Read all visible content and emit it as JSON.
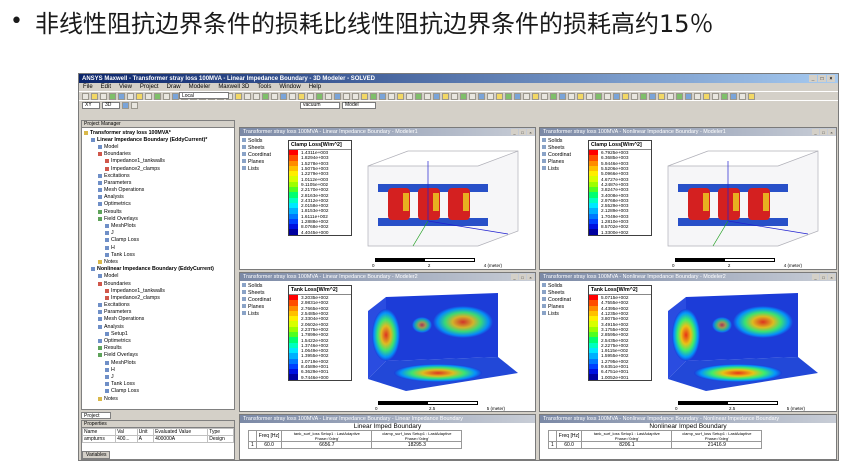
{
  "slide": {
    "bullet": "•",
    "title": "非线性阻抗边界条件的损耗比线性阻抗边界条件的损耗高约15％"
  },
  "app": {
    "title": "ANSYS Maxwell - Transformer stray loss 100MVA - Linear Impedance Boundary - 3D Modeler - SOLVED",
    "menu": [
      "File",
      "Edit",
      "View",
      "Project",
      "Draw",
      "Modeler",
      "Maxwell 3D",
      "Tools",
      "Window",
      "Help"
    ],
    "toolbar": {
      "plane": "XY",
      "mode": "3D",
      "cs": "Local",
      "material": "vacuum",
      "display": "Model"
    }
  },
  "project_manager": {
    "title": "Project Manager",
    "tab": "Project",
    "tree": [
      {
        "label": "Transformer stray loss 100MVA*",
        "level": 0,
        "icon": "project-icon"
      },
      {
        "label": "Linear Impedance Boundary (EddyCurrent)*",
        "level": 1,
        "icon": "design-icon"
      },
      {
        "label": "Model",
        "level": 2,
        "icon": "model-icon"
      },
      {
        "label": "Boundaries",
        "level": 2,
        "icon": "boundary-icon"
      },
      {
        "label": "Impedance1_tankwalls",
        "level": 3,
        "icon": "impedance-icon"
      },
      {
        "label": "Impedance2_clamps",
        "level": 3,
        "icon": "impedance-icon"
      },
      {
        "label": "Excitations",
        "level": 2,
        "icon": "excitation-icon"
      },
      {
        "label": "Parameters",
        "level": 2,
        "icon": "parameter-icon"
      },
      {
        "label": "Mesh Operations",
        "level": 2,
        "icon": "mesh-icon"
      },
      {
        "label": "Analysis",
        "level": 2,
        "icon": "analysis-icon"
      },
      {
        "label": "Optimetrics",
        "level": 2,
        "icon": "optimetrics-icon"
      },
      {
        "label": "Results",
        "level": 2,
        "icon": "results-icon"
      },
      {
        "label": "Field Overlays",
        "level": 2,
        "icon": "field-icon"
      },
      {
        "label": "MeshPlots",
        "level": 3,
        "icon": "folder-icon"
      },
      {
        "label": "J",
        "level": 3,
        "icon": "folder-icon"
      },
      {
        "label": "Clamp Loss",
        "level": 3,
        "icon": "folder-icon"
      },
      {
        "label": "H",
        "level": 3,
        "icon": "folder-icon"
      },
      {
        "label": "Tank Loss",
        "level": 3,
        "icon": "folder-icon"
      },
      {
        "label": "Notes",
        "level": 2,
        "icon": "notes-icon"
      },
      {
        "label": "Nonlinear Impedance Boundary (EddyCurrent)",
        "level": 1,
        "icon": "design-icon"
      },
      {
        "label": "Model",
        "level": 2,
        "icon": "model-icon"
      },
      {
        "label": "Boundaries",
        "level": 2,
        "icon": "boundary-icon"
      },
      {
        "label": "Impedance1_tankwalls",
        "level": 3,
        "icon": "impedance-icon"
      },
      {
        "label": "Impedance2_clamps",
        "level": 3,
        "icon": "impedance-icon"
      },
      {
        "label": "Excitations",
        "level": 2,
        "icon": "excitation-icon"
      },
      {
        "label": "Parameters",
        "level": 2,
        "icon": "parameter-icon"
      },
      {
        "label": "Mesh Operations",
        "level": 2,
        "icon": "mesh-icon"
      },
      {
        "label": "Analysis",
        "level": 2,
        "icon": "analysis-icon"
      },
      {
        "label": "Setup1",
        "level": 3,
        "icon": "setup-icon"
      },
      {
        "label": "Optimetrics",
        "level": 2,
        "icon": "optimetrics-icon"
      },
      {
        "label": "Results",
        "level": 2,
        "icon": "results-icon"
      },
      {
        "label": "Field Overlays",
        "level": 2,
        "icon": "field-icon"
      },
      {
        "label": "MeshPlots",
        "level": 3,
        "icon": "folder-icon"
      },
      {
        "label": "H",
        "level": 3,
        "icon": "folder-icon"
      },
      {
        "label": "J",
        "level": 3,
        "icon": "folder-icon"
      },
      {
        "label": "Tank Loss",
        "level": 3,
        "icon": "folder-icon"
      },
      {
        "label": "Clamp Loss",
        "level": 3,
        "icon": "folder-icon"
      },
      {
        "label": "Notes",
        "level": 2,
        "icon": "notes-icon"
      }
    ]
  },
  "properties": {
    "title": "Properties",
    "headers": [
      "Name",
      "Val",
      "Unit",
      "Evaluated Value",
      "Type"
    ],
    "row": [
      "ampturns",
      "400...",
      "A",
      "400000A",
      "Design"
    ],
    "tab": "Variables"
  },
  "viewer_tree": [
    "Solids",
    "Sheets",
    "Coordinat",
    "Planes",
    "Lists"
  ],
  "viewers": [
    {
      "title": "Transformer stray loss 100MVA - Linear Impedance Boundary - Modeler1",
      "legend_title": "Clamp Loss[W/m^2]",
      "legend_values": [
        "1.4311e+003",
        "1.8294e+003",
        "1.5278e+003",
        "1.5075e+003",
        "1.2279e+003",
        "1.0112e+003",
        "9.1105e+002",
        "2.2170e+002",
        "2.8163e+002",
        "2.4312e+002",
        "2.0158e+002",
        "1.8153e+002",
        "1.6111e+002",
        "1.2888e+002",
        "8.0768e+002",
        "4.4045e+000"
      ],
      "scale": [
        "0",
        "2",
        "4 (meter)"
      ]
    },
    {
      "title": "Transformer stray loss 100MVA - Nonlinear Impedance Boundary - Modeler1",
      "legend_title": "Clamp Loss[W/m^2]",
      "legend_values": [
        "6.7925e+003",
        "6.3685e+003",
        "5.9446e+003",
        "5.5206e+003",
        "5.0966e+003",
        "4.6727e+003",
        "4.2487e+003",
        "3.8247e+003",
        "3.4008e+003",
        "2.9768e+003",
        "2.5529e+003",
        "2.1289e+003",
        "1.7049e+003",
        "1.2810e+003",
        "8.5702e+002",
        "1.3300e+002"
      ],
      "scale": [
        "0",
        "2",
        "4 (meter)"
      ]
    },
    {
      "title": "Transformer stray loss 100MVA - Linear Impedance Boundary - Modeler2",
      "legend_title": "Tank Loss[W/m^2]",
      "legend_values": [
        "3.2035e+002",
        "2.9831e+002",
        "2.7665e+002",
        "2.5485e+002",
        "2.3304e+002",
        "2.0602e+002",
        "2.2375e+002",
        "1.7899e+002",
        "1.5422e+002",
        "1.3746e+002",
        "1.0649e+002",
        "1.3955e+002",
        "1.0719e+002",
        "8.4589e+001",
        "6.3629e+001",
        "9.7446e+000"
      ],
      "scale": [
        "0",
        "2.5",
        "5 (meter)"
      ]
    },
    {
      "title": "Transformer stray loss 100MVA - Nonlinear Impedance Boundary - Modeler2",
      "legend_title": "Tank Loss[W/m^2]",
      "legend_values": [
        "5.0715e+002",
        "4.7555e+002",
        "4.4395e+002",
        "4.1235e+002",
        "3.8075e+002",
        "3.4915e+002",
        "3.1755e+002",
        "2.8595e+002",
        "2.5435e+002",
        "2.2275e+002",
        "1.9115e+002",
        "1.5955e+002",
        "1.2795e+002",
        "9.6351e+001",
        "6.4751e+001",
        "1.0052e+001"
      ],
      "scale": [
        "0",
        "2.5",
        "5 (meter)"
      ]
    }
  ],
  "reports": [
    {
      "title": "Transformer stray loss 100MVA - Linear Impedance Boundary - Linear Impedance Boundary",
      "heading": "Linear Imped Boundary",
      "col_headers": [
        "Freq [Hz]",
        "tank_surf_loss Setup1 : LastAdaptive Phase='0deg'",
        "clamp_surf_loss Setup1 : LastAdaptive Phase='0deg'"
      ],
      "row": [
        "1",
        "60.0",
        "6656.7",
        "18295.3"
      ]
    },
    {
      "title": "Transformer stray loss 100MVA - Nonlinear Impedance Boundary - Nonlinear Impedance Boundary",
      "heading": "Nonlinear Imped Boundary",
      "col_headers": [
        "Freq [Hz]",
        "tank_surf_loss Setup1 : LastAdaptive Phase='0deg'",
        "clamp_surf_loss Setup1 : LastAdaptive Phase='0deg'"
      ],
      "row": [
        "1",
        "60.0",
        "8206.1",
        "21416.9"
      ]
    }
  ],
  "colors": {
    "legend_scale": [
      "#ff0000",
      "#ff4d00",
      "#ff8c00",
      "#ffc000",
      "#ffee00",
      "#d8ff00",
      "#9cff00",
      "#50ff20",
      "#00ff70",
      "#00ffc0",
      "#00e8ff",
      "#00b0ff",
      "#0078ff",
      "#0040ff",
      "#0010e0",
      "#0000a0"
    ]
  }
}
